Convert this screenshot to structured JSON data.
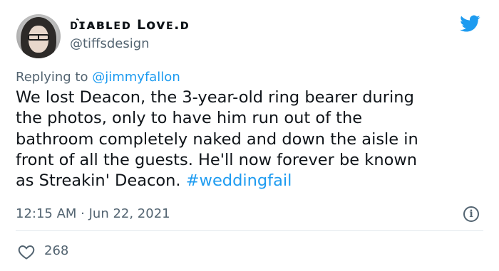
{
  "tweet": {
    "author_name": "ᴅ͛ɪᴀʙʟᴇᴅ Lᴏᴠᴇ.ᴅ",
    "handle": "@tiffsdesign",
    "replying_prefix": "Replying to",
    "replying_mention": "@jimmyfallon",
    "body_lines": [
      "We lost Deacon, the 3-year-old ring bearer during",
      "the photos, only to have him run out of the",
      "bathroom completely naked and down the aisle in",
      "front of all the guests. He'll now forever be known",
      "as Streakin' Deacon. "
    ],
    "hashtag": "#weddingfail",
    "timestamp": "12:15 AM · Jun 22, 2021",
    "likes": "268"
  },
  "icons": {
    "brand": "twitter-bird-icon",
    "info": "info-icon",
    "like": "heart-icon"
  },
  "colors": {
    "link": "#1d9bf0",
    "muted": "#536471",
    "text": "#0f1419"
  }
}
